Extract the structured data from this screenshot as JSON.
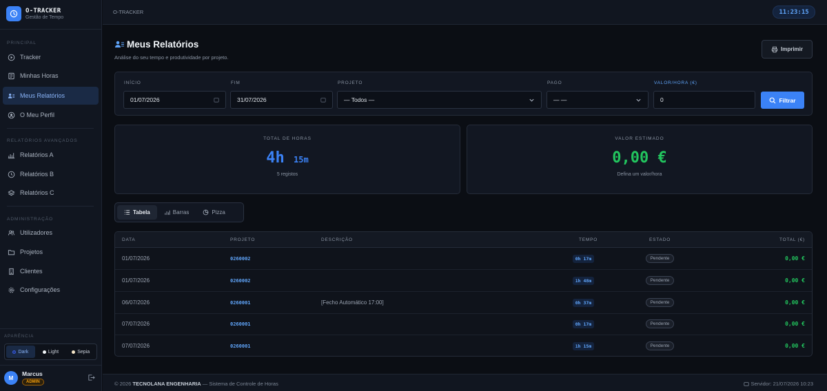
{
  "brand": {
    "title": "O-TRACKER",
    "subtitle": "Gestão de Tempo"
  },
  "sidebar": {
    "sections": [
      {
        "label": "PRINCIPAL",
        "items": [
          {
            "label": "Tracker",
            "icon": "play-circle-icon"
          },
          {
            "label": "Minhas Horas",
            "icon": "document-icon"
          },
          {
            "label": "Meus Relatórios",
            "icon": "users-list-icon",
            "active": true
          },
          {
            "label": "O Meu Perfil",
            "icon": "user-circle-icon"
          }
        ]
      },
      {
        "label": "RELATÓRIOS AVANÇADOS",
        "items": [
          {
            "label": "Relatórios A",
            "icon": "bar-chart-icon"
          },
          {
            "label": "Relatórios B",
            "icon": "clock-icon"
          },
          {
            "label": "Relatórios C",
            "icon": "layers-icon"
          }
        ]
      },
      {
        "label": "ADMINISTRAÇÃO",
        "items": [
          {
            "label": "Utilizadores",
            "icon": "users-icon"
          },
          {
            "label": "Projetos",
            "icon": "folder-icon"
          },
          {
            "label": "Clientes",
            "icon": "building-icon"
          },
          {
            "label": "Configurações",
            "icon": "gear-icon"
          }
        ]
      }
    ],
    "appearance": {
      "label": "APARÊNCIA",
      "options": [
        {
          "label": "Dark",
          "active": true,
          "dot_color": "#1e3a8a"
        },
        {
          "label": "Light",
          "active": false,
          "dot_color": "#f1f5f9"
        },
        {
          "label": "Sepia",
          "active": false,
          "dot_color": "#f5e6c8"
        }
      ]
    },
    "user": {
      "initial": "M",
      "name": "Marcus",
      "role": "ADMIN"
    }
  },
  "topbar": {
    "breadcrumb": "O-TRACKER",
    "clock": "11:23:15"
  },
  "page": {
    "title": "Meus Relatórios",
    "subtitle": "Análise do seu tempo e produtividade por projeto.",
    "print_label": "Imprimir"
  },
  "filters": {
    "start": {
      "label": "INÍCIO",
      "value": "01/07/2026"
    },
    "end": {
      "label": "FIM",
      "value": "31/07/2026"
    },
    "project": {
      "label": "PROJETO",
      "value": "— Todos —"
    },
    "paid": {
      "label": "PAGO",
      "value": "— —"
    },
    "rate": {
      "label": "VALOR/HORA (€)",
      "value": "0"
    },
    "submit_label": "Filtrar"
  },
  "stats": {
    "total_hours": {
      "label": "TOTAL DE HORAS",
      "hours": "4h",
      "minutes": "15m",
      "sub": "5 registos"
    },
    "estimated": {
      "label": "VALOR ESTIMADO",
      "value": "0,00 €",
      "sub": "Defina um valor/hora"
    }
  },
  "tabs": [
    {
      "label": "Tabela",
      "icon": "list-icon",
      "active": true
    },
    {
      "label": "Barras",
      "icon": "bar-chart-icon",
      "active": false
    },
    {
      "label": "Pizza",
      "icon": "pie-chart-icon",
      "active": false
    }
  ],
  "table": {
    "headers": {
      "date": "DATA",
      "project": "PROJETO",
      "description": "DESCRIÇÃO",
      "time": "TEMPO",
      "state": "ESTADO",
      "total": "TOTAL (€)"
    },
    "rows": [
      {
        "date": "01/07/2026",
        "project": "0260002",
        "description": "",
        "time": "0h 17m",
        "state": "Pendente",
        "total": "0,00 €"
      },
      {
        "date": "01/07/2026",
        "project": "0260002",
        "description": "",
        "time": "1h 48m",
        "state": "Pendente",
        "total": "0,00 €"
      },
      {
        "date": "06/07/2026",
        "project": "0260001",
        "description": "[Fecho Automático 17:00]",
        "time": "0h 37m",
        "state": "Pendente",
        "total": "0,00 €"
      },
      {
        "date": "07/07/2026",
        "project": "0260001",
        "description": "",
        "time": "0h 17m",
        "state": "Pendente",
        "total": "0,00 €"
      },
      {
        "date": "07/07/2026",
        "project": "0260001",
        "description": "",
        "time": "1h 15m",
        "state": "Pendente",
        "total": "0,00 €"
      }
    ]
  },
  "footer": {
    "copyright": "© 2026",
    "company": "TECNOLANA ENGENHARIA",
    "tagline": "— Sistema de Controle de Horas",
    "server": "Servidor: 21/07/2026 10:23"
  },
  "colors": {
    "accent": "#3b82f6",
    "success": "#22c55e",
    "background": "#0b0e14"
  }
}
